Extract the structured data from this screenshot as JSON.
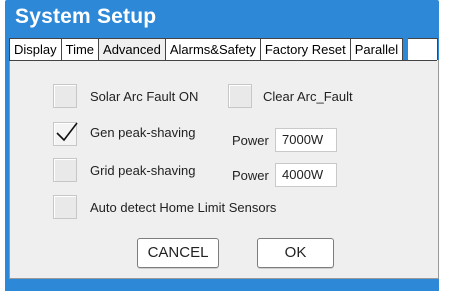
{
  "window": {
    "title": "System Setup"
  },
  "tabs": [
    {
      "label": "Display"
    },
    {
      "label": "Time"
    },
    {
      "label": "Advanced",
      "active": true
    },
    {
      "label": "Alarms&Safety"
    },
    {
      "label": "Factory Reset"
    },
    {
      "label": "Parallel"
    }
  ],
  "options": {
    "solar_arc_fault": {
      "label": "Solar Arc Fault ON",
      "checked": false
    },
    "clear_arc_fault": {
      "label": "Clear Arc_Fault",
      "checked": false
    },
    "gen_peak_shaving": {
      "label": "Gen peak-shaving",
      "checked": true,
      "power_label": "Power",
      "power_value": "7000W"
    },
    "grid_peak_shaving": {
      "label": "Grid peak-shaving",
      "checked": false,
      "power_label": "Power",
      "power_value": "4000W"
    },
    "auto_detect": {
      "label": "Auto detect Home Limit Sensors",
      "checked": false
    }
  },
  "buttons": {
    "cancel": "CANCEL",
    "ok": "OK"
  },
  "colors": {
    "titlebar": "#2e88d8",
    "panel": "#efefef"
  },
  "icons": {
    "check": "check-icon"
  }
}
